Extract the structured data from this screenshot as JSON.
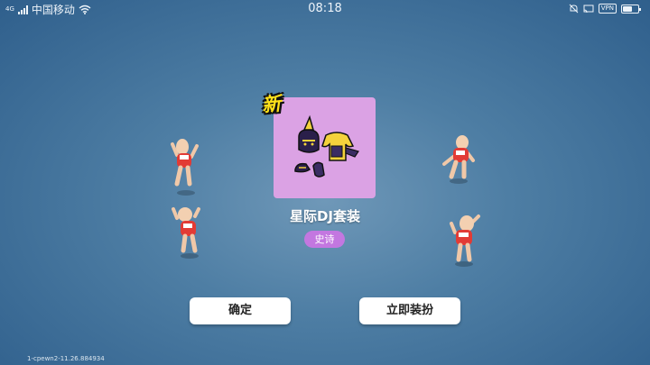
{
  "status_bar": {
    "network_type": "4G",
    "carrier": "中国移动",
    "time": "08:18",
    "vpn_label": "VPN",
    "battery_percent": 60
  },
  "reward": {
    "new_label": "新",
    "item_name": "星际DJ套装",
    "rarity": "史诗",
    "card_color": "#dba2e4",
    "rarity_color": "#c377e0"
  },
  "buttons": {
    "confirm": "确定",
    "equip_now": "立即装扮"
  },
  "footer": {
    "version": "1-cpewn2-11.26.884934"
  }
}
